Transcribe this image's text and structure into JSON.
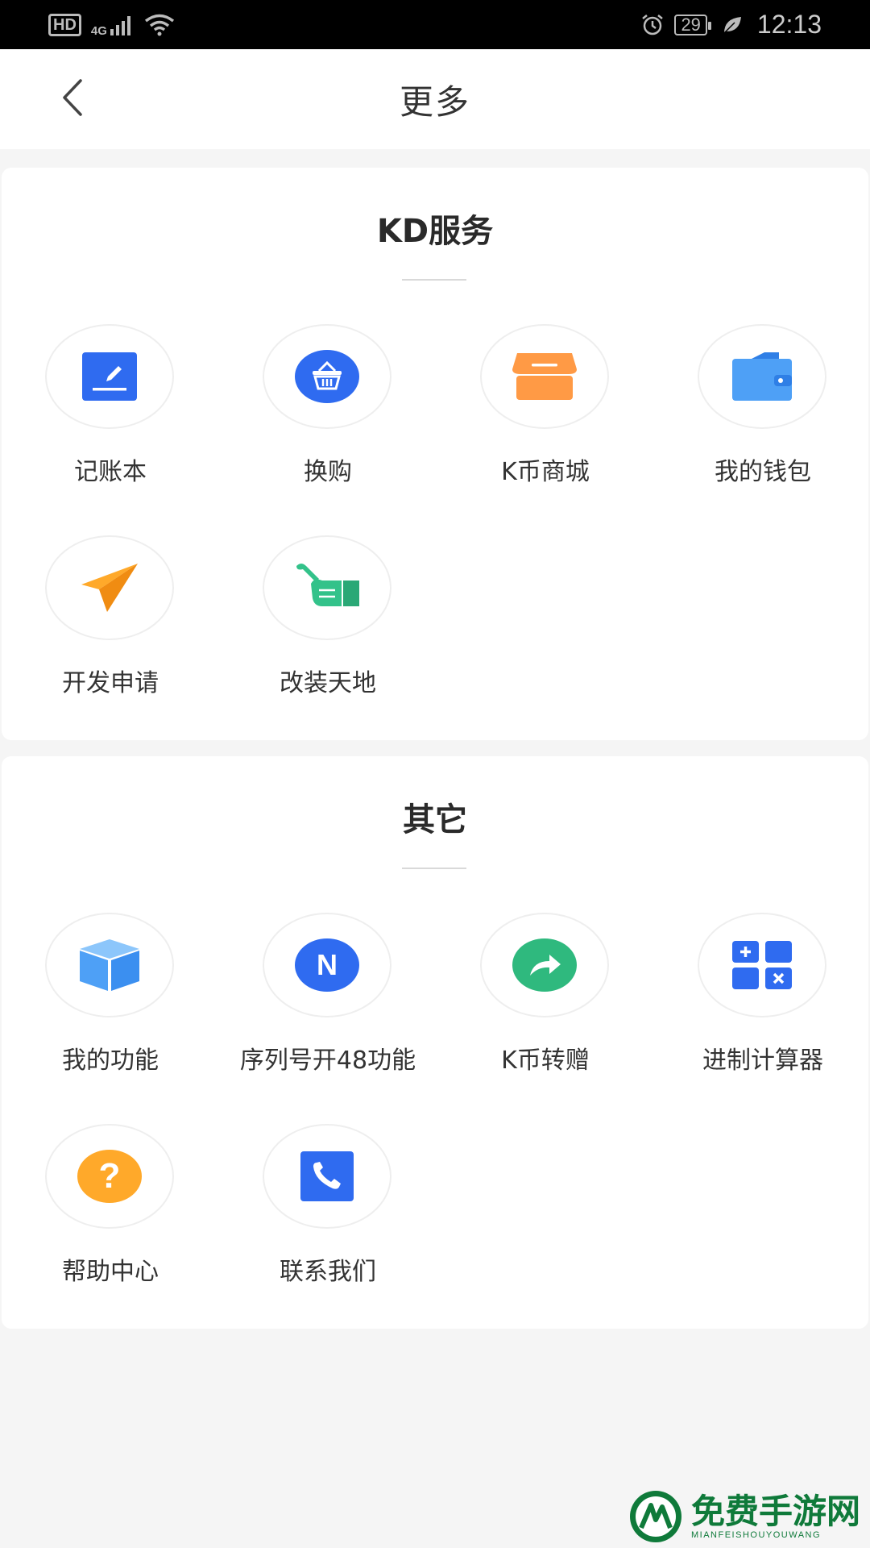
{
  "status_bar": {
    "hd": "HD",
    "network": "4G",
    "battery": "29",
    "time": "12:13"
  },
  "header": {
    "title": "更多"
  },
  "sections": [
    {
      "title": "KD服务",
      "items": [
        {
          "label": "记账本",
          "icon": "edit-icon",
          "color": "#2f6bf0"
        },
        {
          "label": "换购",
          "icon": "basket-icon",
          "color": "#2f6bf0"
        },
        {
          "label": "K币商城",
          "icon": "shop-icon",
          "color": "#ff9a45"
        },
        {
          "label": "我的钱包",
          "icon": "wallet-icon",
          "color": "#4ea0f6"
        },
        {
          "label": "开发申请",
          "icon": "paper-plane-icon",
          "color": "#ffa92a"
        },
        {
          "label": "改装天地",
          "icon": "wrench-hand-icon",
          "color": "#33c28a"
        }
      ]
    },
    {
      "title": "其它",
      "items": [
        {
          "label": "我的功能",
          "icon": "cube-icon",
          "color": "#4ea0f6"
        },
        {
          "label": "序列号开48功能",
          "icon": "n-badge-icon",
          "color": "#2f6bf0",
          "glyph": "N"
        },
        {
          "label": "K币转赠",
          "icon": "share-icon",
          "color": "#2fb97e"
        },
        {
          "label": "进制计算器",
          "icon": "calculator-icon",
          "color": "#2f6bf0"
        },
        {
          "label": "帮助中心",
          "icon": "question-icon",
          "color": "#ffa92a",
          "glyph": "?"
        },
        {
          "label": "联系我们",
          "icon": "phone-icon",
          "color": "#2f6bf0"
        }
      ]
    }
  ],
  "watermark": {
    "cn": "免费手游网",
    "en": "MIANFEISHOUYOUWANG"
  }
}
